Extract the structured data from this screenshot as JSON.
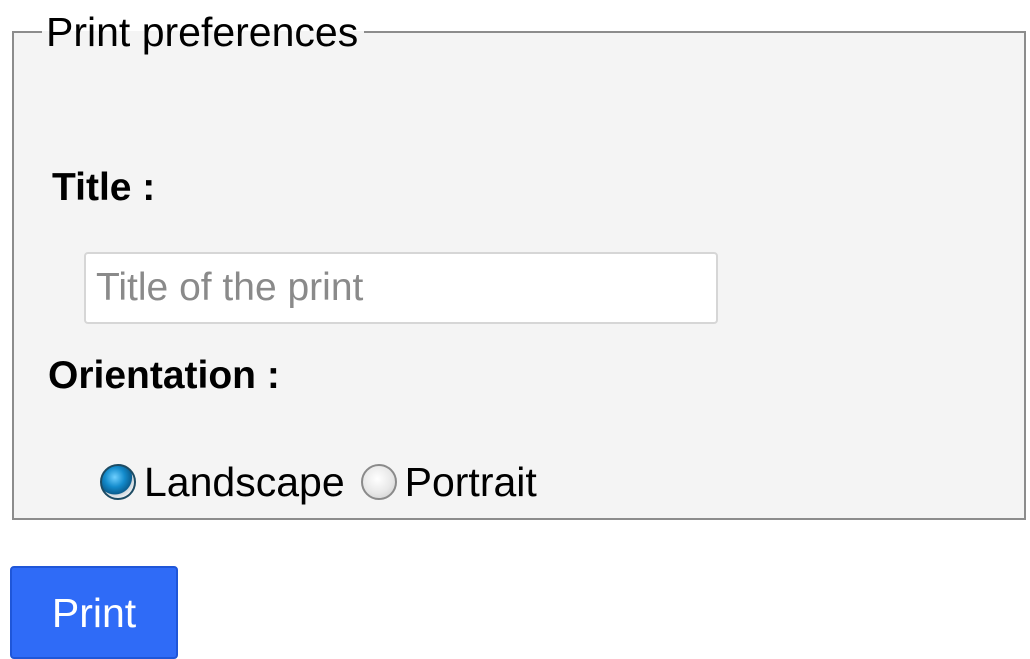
{
  "fieldset": {
    "legend": "Print preferences"
  },
  "title_field": {
    "label": "Title :",
    "value": "",
    "placeholder": "Title of the print"
  },
  "orientation": {
    "label": "Orientation :",
    "options": [
      {
        "label": "Landscape",
        "checked": true,
        "icon": "radio-checked-icon"
      },
      {
        "label": "Portrait",
        "checked": false,
        "icon": "radio-unchecked-icon"
      }
    ]
  },
  "actions": {
    "print_label": "Print"
  },
  "colors": {
    "button_bg": "#2f6bf7",
    "panel_bg": "#f4f4f4",
    "radio_accent": "#138bcc"
  }
}
